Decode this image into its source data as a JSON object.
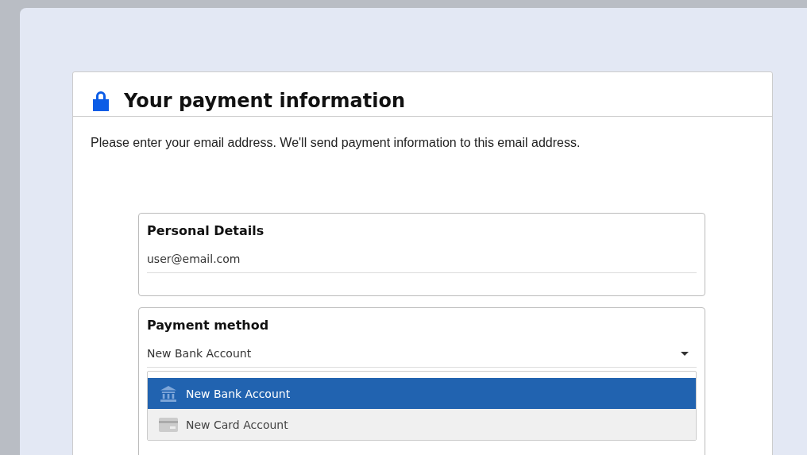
{
  "title": "Your payment information",
  "intro": "Please enter your email address. We'll send payment information to this email address.",
  "personal_details": {
    "heading": "Personal Details",
    "email": "user@email.com"
  },
  "payment_method": {
    "heading": "Payment method",
    "value": "New Bank Account",
    "options": [
      {
        "label": "New Bank Account",
        "kind": "bank",
        "selected": true
      },
      {
        "label": "New Card Account",
        "kind": "card",
        "selected": false
      }
    ]
  }
}
